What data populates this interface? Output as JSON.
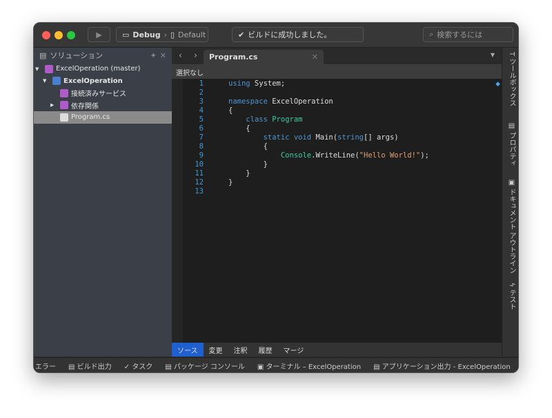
{
  "toolbar": {
    "config": "Debug",
    "device": "Default",
    "build_status": "ビルドに成功しました。",
    "search_placeholder": "検索するには"
  },
  "solution": {
    "title": "ソリューション",
    "items": [
      {
        "label": "ExcelOperation (master)",
        "level": 0,
        "expander": "▼",
        "color": "#b05cc8"
      },
      {
        "label": "ExcelOperation",
        "level": 1,
        "expander": "▼",
        "color": "#4a7fd0",
        "bold": true
      },
      {
        "label": "接続済みサービス",
        "level": 2,
        "expander": "",
        "color": "#b05cc8"
      },
      {
        "label": "依存関係",
        "level": 2,
        "expander": "▶",
        "color": "#b05cc8"
      },
      {
        "label": "Program.cs",
        "level": 2,
        "expander": "",
        "color": "#ddd",
        "selected": true
      }
    ]
  },
  "editor": {
    "tab": "Program.cs",
    "breadcrumb": "選択なし",
    "lines": [
      [
        [
          "kw",
          "using"
        ],
        [
          "tx",
          " System;"
        ]
      ],
      [],
      [
        [
          "kw",
          "namespace"
        ],
        [
          "tx",
          " ExcelOperation"
        ]
      ],
      [
        [
          "tx",
          "{"
        ]
      ],
      [
        [
          "tx",
          "    "
        ],
        [
          "kw",
          "class"
        ],
        [
          "tx",
          " "
        ],
        [
          "ty",
          "Program"
        ]
      ],
      [
        [
          "tx",
          "    {"
        ]
      ],
      [
        [
          "tx",
          "        "
        ],
        [
          "kw",
          "static"
        ],
        [
          "tx",
          " "
        ],
        [
          "kw",
          "void"
        ],
        [
          "tx",
          " Main("
        ],
        [
          "kw",
          "string"
        ],
        [
          "tx",
          "[] args)"
        ]
      ],
      [
        [
          "tx",
          "        {"
        ]
      ],
      [
        [
          "tx",
          "            "
        ],
        [
          "ty",
          "Console"
        ],
        [
          "tx",
          ".WriteLine("
        ],
        [
          "str",
          "\"Hello World!\""
        ],
        [
          "tx",
          ");"
        ]
      ],
      [
        [
          "tx",
          "        }"
        ]
      ],
      [
        [
          "tx",
          "    }"
        ]
      ],
      [
        [
          "tx",
          "}"
        ]
      ],
      []
    ],
    "bottom_tabs": [
      "ソース",
      "変更",
      "注釈",
      "履歴",
      "マージ"
    ]
  },
  "right_panel": [
    "ツールボックス",
    "プロパティ",
    "ドキュメント アウトライン",
    "テスト"
  ],
  "status_bar": [
    "エラー",
    "ビルド出力",
    "タスク",
    "パッケージ コンソール",
    "ターミナル – ExcelOperation",
    "アプリケーション出力 - ExcelOperation"
  ]
}
